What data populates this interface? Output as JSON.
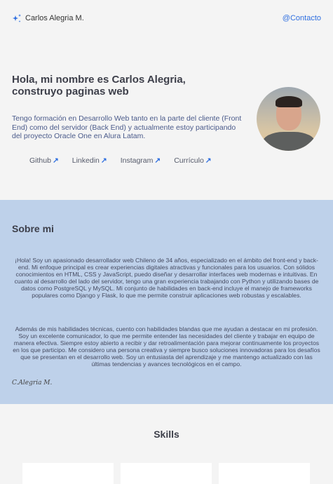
{
  "header": {
    "brand": "Carlos Alegria M.",
    "contact": "@Contacto"
  },
  "hero": {
    "title": "Hola, mi nombre es Carlos Alegria, construyo paginas web",
    "intro": "Tengo formación en Desarrollo Web tanto en la parte del cliente (Front End) como del servidor (Back End) y actualmente estoy participando del proyecto Oracle One en Alura Latam.",
    "links": [
      {
        "label": "Github"
      },
      {
        "label": "Linkedin"
      },
      {
        "label": "Instagram"
      },
      {
        "label": "Currículo"
      }
    ],
    "arrow": "↗"
  },
  "about": {
    "title": "Sobre mi",
    "p1": "¡Hola! Soy un apasionado desarrollador web Chileno de 34 años, especializado en el ámbito del front-end y back-end. Mi enfoque principal es crear experiencias digitales atractivas y funcionales para los usuarios. Con sólidos conocimientos en HTML, CSS y JavaScript, puedo diseñar y desarrollar interfaces web modernas e intuitivas. En cuanto al desarrollo del lado del servidor, tengo una gran experiencia trabajando con Python y utilizando bases de datos como PostgreSQL y MySQL. Mi conjunto de habilidades en back-end incluye el manejo de frameworks populares como Django y Flask, lo que me permite construir aplicaciones web robustas y escalables.",
    "p2": "Además de mis habilidades técnicas, cuento con habilidades blandas que me ayudan a destacar en mi profesión. Soy un excelente comunicador, lo que me permite entender las necesidades del cliente y trabajar en equipo de manera efectiva. Siempre estoy abierto a recibir y dar retroalimentación para mejorar continuamente los proyectos en los que participo. Me considero una persona creativa y siempre busco soluciones innovadoras para los desafíos que se presentan en el desarrollo web. Soy un entusiasta del aprendizaje y me mantengo actualizado con las últimas tendencias y avances tecnológicos en el campo.",
    "signature": "C.Alegria M."
  },
  "skills": {
    "title": "Skills"
  }
}
